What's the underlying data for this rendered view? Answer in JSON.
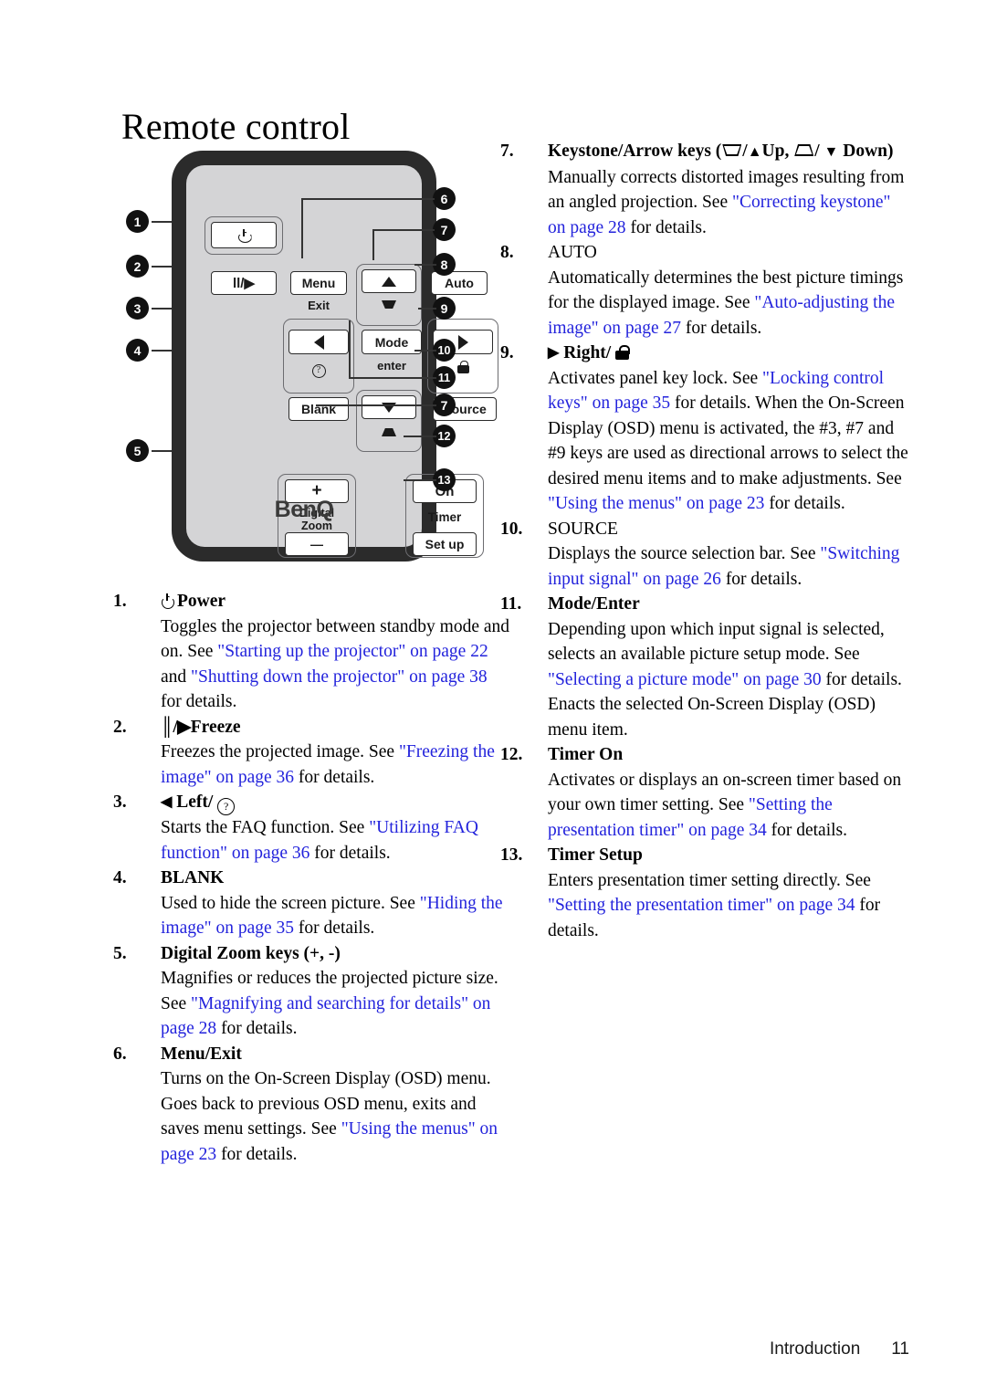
{
  "page_title": "Remote control",
  "footer": {
    "section": "Introduction",
    "page_number": "11"
  },
  "colors": {
    "link": "#2323dc",
    "text": "#000000",
    "remote_body": "#2b2b2b",
    "remote_face": "#d4d4d6"
  },
  "remote": {
    "brand": "BenQ",
    "buttons": [
      {
        "name": "power",
        "label": "",
        "icon": "power-icon"
      },
      {
        "name": "freeze",
        "label": "ll/▶",
        "icon": "pause-play-icon"
      },
      {
        "name": "menu",
        "label": "Menu"
      },
      {
        "name": "exit",
        "label": "Exit"
      },
      {
        "name": "up-arrow",
        "label": "",
        "icon": "triangle-up-icon"
      },
      {
        "name": "keystone-down",
        "label": "",
        "icon": "keystone-a-icon"
      },
      {
        "name": "auto",
        "label": "Auto"
      },
      {
        "name": "left-arrow",
        "label": "",
        "icon": "triangle-left-icon"
      },
      {
        "name": "help",
        "label": "?",
        "icon": "help-icon"
      },
      {
        "name": "mode",
        "label": "Mode"
      },
      {
        "name": "enter",
        "label": "enter"
      },
      {
        "name": "right-arrow",
        "label": "",
        "icon": "triangle-right-icon"
      },
      {
        "name": "lock",
        "label": "",
        "icon": "lock-icon"
      },
      {
        "name": "blank",
        "label": "Blank"
      },
      {
        "name": "down-arrow",
        "label": "",
        "icon": "triangle-down-icon"
      },
      {
        "name": "keystone-up",
        "label": "",
        "icon": "keystone-b-icon"
      },
      {
        "name": "source",
        "label": "Source"
      },
      {
        "name": "digital-zoom-plus",
        "label": "+"
      },
      {
        "name": "digital-zoom-minus",
        "label": "—"
      },
      {
        "name": "digital-zoom-label-1",
        "label": "Digital"
      },
      {
        "name": "digital-zoom-label-2",
        "label": "Zoom"
      },
      {
        "name": "timer-on",
        "label": "On"
      },
      {
        "name": "timer-label",
        "label": "Timer"
      },
      {
        "name": "timer-setup",
        "label": "Set up"
      }
    ],
    "callouts_left": [
      "1",
      "2",
      "3",
      "4",
      "5"
    ],
    "callouts_right": [
      "6",
      "7",
      "8",
      "9",
      "10",
      "11",
      "7",
      "12",
      "13"
    ]
  },
  "left_column": [
    {
      "num": "1.",
      "heading": "Power",
      "heading_icon": "power-icon",
      "body": [
        {
          "t": "Toggles the projector between standby mode and on. See ",
          "c": "blk"
        },
        {
          "t": "\"Starting up the projector\" on page 22",
          "c": "lnk"
        },
        {
          "t": " and ",
          "c": "blk"
        },
        {
          "t": "\"Shutting down the projector\" on page 38",
          "c": "lnk"
        },
        {
          "t": " for details.",
          "c": "blk"
        }
      ]
    },
    {
      "num": "2.",
      "heading": "Freeze",
      "heading_icon": "pause-play-icon",
      "body": [
        {
          "t": "Freezes the projected image. See ",
          "c": "blk"
        },
        {
          "t": "\"Freezing the image\" on page 36",
          "c": "lnk"
        },
        {
          "t": " for details.",
          "c": "blk"
        }
      ]
    },
    {
      "num": "3.",
      "heading": "Left/",
      "heading_icon": "triangle-left-icon",
      "heading_icon2": "help-icon",
      "body": [
        {
          "t": "Starts the FAQ function. See ",
          "c": "blk"
        },
        {
          "t": "\"Utilizing FAQ function\" on page 36",
          "c": "lnk"
        },
        {
          "t": " for details.",
          "c": "blk"
        }
      ]
    },
    {
      "num": "4.",
      "heading": "BLANK",
      "body": [
        {
          "t": "Used to hide the screen picture. See ",
          "c": "blk"
        },
        {
          "t": "\"Hiding the image\" on page 35",
          "c": "lnk"
        },
        {
          "t": " for details.",
          "c": "blk"
        }
      ]
    },
    {
      "num": "5.",
      "heading": "Digital Zoom keys (+, -)",
      "body": [
        {
          "t": "Magnifies or reduces the projected picture size. See ",
          "c": "blk"
        },
        {
          "t": "\"Magnifying and searching for details\" on page 28",
          "c": "lnk"
        },
        {
          "t": " for details.",
          "c": "blk"
        }
      ]
    },
    {
      "num": "6.",
      "heading": "Menu/Exit",
      "body": [
        {
          "t": "Turns on the On-Screen Display (OSD) menu. Goes back to previous OSD menu, exits and saves menu settings. See ",
          "c": "blk"
        },
        {
          "t": "\"Using the menus\" on page 23",
          "c": "lnk"
        },
        {
          "t": " for details.",
          "c": "blk"
        }
      ]
    }
  ],
  "right_column": [
    {
      "num": "7.",
      "heading": "Keystone/Arrow keys (",
      "heading_tail": "Up,",
      "heading_tail2": "Down)",
      "body": [
        {
          "t": "Manually corrects distorted images resulting from an angled projection. See ",
          "c": "blk"
        },
        {
          "t": "\"Correcting keystone\" on page 28",
          "c": "lnk"
        },
        {
          "t": " for details.",
          "c": "blk"
        }
      ]
    },
    {
      "num": "8.",
      "heading": "AUTO",
      "body": [
        {
          "t": "Automatically determines the best picture timings for the displayed image. See ",
          "c": "blk"
        },
        {
          "t": "\"Auto-adjusting the image\" on page 27",
          "c": "lnk"
        },
        {
          "t": " for details.",
          "c": "blk"
        }
      ]
    },
    {
      "num": "9.",
      "heading": "Right/",
      "heading_icon": "triangle-right-icon",
      "heading_icon2": "lock-icon",
      "body": [
        {
          "t": "Activates panel key lock. See ",
          "c": "blk"
        },
        {
          "t": "\"Locking control keys\" on page 35",
          "c": "lnk"
        },
        {
          "t": " for details. ",
          "c": "blk"
        },
        {
          "t": "When the On-Screen Display (OSD) menu is activated, the #3, #7 and #9 keys are used as directional arrows to select the desired menu items and to make adjustments. See ",
          "c": "blk"
        },
        {
          "t": "\"Using the menus\" on page 23",
          "c": "lnk"
        },
        {
          "t": " for details.",
          "c": "blk"
        }
      ]
    },
    {
      "num": "10.",
      "heading": "SOURCE",
      "body": [
        {
          "t": "Displays the source selection bar. See ",
          "c": "blk"
        },
        {
          "t": "\"Switching input signal\" on page 26",
          "c": "lnk"
        },
        {
          "t": " for details.",
          "c": "blk"
        }
      ]
    },
    {
      "num": "11.",
      "heading": "Mode/Enter",
      "body": [
        {
          "t": "Depending upon which input signal is selected, selects an available picture setup mode. See ",
          "c": "blk"
        },
        {
          "t": "\"Selecting a picture mode\" on page 30",
          "c": "lnk"
        },
        {
          "t": " for details. ",
          "c": "blk"
        },
        {
          "t": "Enacts the selected On-Screen Display (OSD) menu item.",
          "c": "blk"
        }
      ]
    },
    {
      "num": "12.",
      "heading": "Timer On",
      "body": [
        {
          "t": "Activates or displays an on-screen timer based on your own timer setting. See ",
          "c": "blk"
        },
        {
          "t": "\"Setting the presentation timer\" on page 34",
          "c": "lnk"
        },
        {
          "t": " for details.",
          "c": "blk"
        }
      ]
    },
    {
      "num": "13.",
      "heading": "Timer Setup",
      "body": [
        {
          "t": "Enters presentation timer setting directly. See ",
          "c": "blk"
        },
        {
          "t": "\"Setting the presentation timer\" on page 34",
          "c": "lnk"
        },
        {
          "t": " for details.",
          "c": "blk"
        }
      ]
    }
  ]
}
